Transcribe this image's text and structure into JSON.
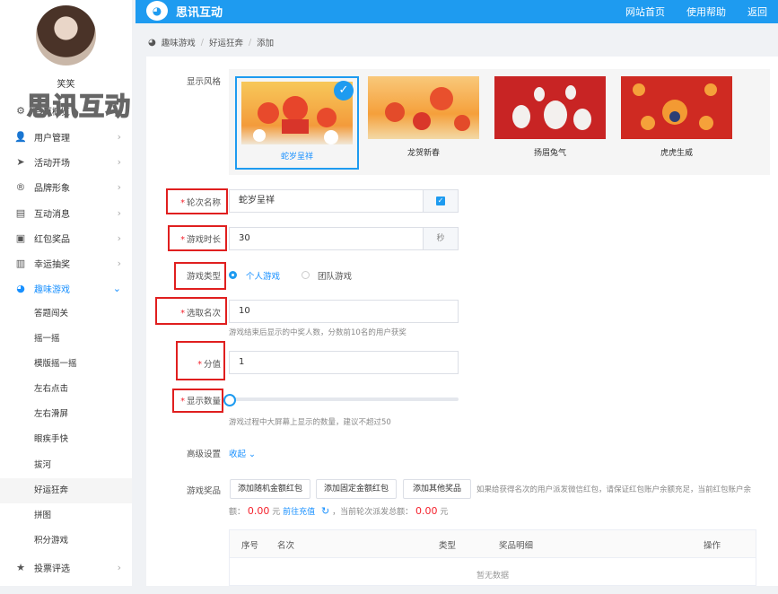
{
  "header": {
    "brand": "思讯互动",
    "nav": [
      "网站首页",
      "使用帮助",
      "返回"
    ]
  },
  "user": {
    "name": "笑笑",
    "watermark": "思讯互动"
  },
  "sidebar": {
    "items": [
      {
        "label": "首页概览",
        "icon": "gear-icon"
      },
      {
        "label": "用户管理",
        "icon": "user-icon"
      },
      {
        "label": "活动开场",
        "icon": "send-icon"
      },
      {
        "label": "品牌形象",
        "icon": "registered-icon"
      },
      {
        "label": "互动消息",
        "icon": "message-icon"
      },
      {
        "label": "红包奖品",
        "icon": "red-packet-icon"
      },
      {
        "label": "幸运抽奖",
        "icon": "lottery-icon"
      },
      {
        "label": "趣味游戏",
        "icon": "game-icon"
      }
    ],
    "subitems": [
      "答题闯关",
      "摇一摇",
      "模版摇一摇",
      "左右点击",
      "左右滑屏",
      "眼疾手快",
      "拔河",
      "好运狂奔",
      "拼图",
      "积分游戏"
    ],
    "bottom_item": {
      "label": "投票评选",
      "icon": "star-icon"
    }
  },
  "breadcrumb": [
    "趣味游戏",
    "好运狂奔",
    "添加"
  ],
  "form": {
    "style_label": "显示风格",
    "styles": [
      {
        "name": "蛇岁呈祥",
        "selected": true,
        "color": "#f3b33d"
      },
      {
        "name": "龙贺新春",
        "selected": false,
        "color": "#f6a23a"
      },
      {
        "name": "扬眉兔气",
        "selected": false,
        "color": "#c82424"
      },
      {
        "name": "虎虎生威",
        "selected": false,
        "color": "#cf2a22"
      }
    ],
    "round_name": {
      "label": "轮次名称",
      "value": "蛇岁呈祥"
    },
    "duration": {
      "label": "游戏时长",
      "value": "30",
      "unit": "秒"
    },
    "game_type": {
      "label": "游戏类型",
      "options": [
        "个人游戏",
        "团队游戏"
      ],
      "selected": "个人游戏"
    },
    "winners": {
      "label": "选取名次",
      "value": "10",
      "hint": "游戏结束后显示的中奖人数，分数前10名的用户获奖"
    },
    "score": {
      "label": "分值",
      "value": "1"
    },
    "display_count": {
      "label": "显示数量",
      "value": 0,
      "hint": "游戏过程中大屏幕上显示的数量，建议不超过50"
    },
    "advanced": {
      "label": "高级设置",
      "toggle": "收起"
    },
    "prizes": {
      "label": "游戏奖品",
      "buttons": [
        "添加随机金额红包",
        "添加固定金额红包",
        "添加其他奖品"
      ],
      "note_1": "如果给获得名次的用户派发微信红包，请保证红包账户余额充足，当前红包账户余",
      "note_2": "额：",
      "balance": "0.00",
      "currency": "元",
      "recharge": "前往充值",
      "note_3": "，当前轮次派发总额：",
      "total": "0.00",
      "total_unit": "元"
    },
    "table": {
      "columns": [
        "序号",
        "名次",
        "类型",
        "奖品明细",
        "操作"
      ],
      "empty": "暂无数据"
    }
  }
}
